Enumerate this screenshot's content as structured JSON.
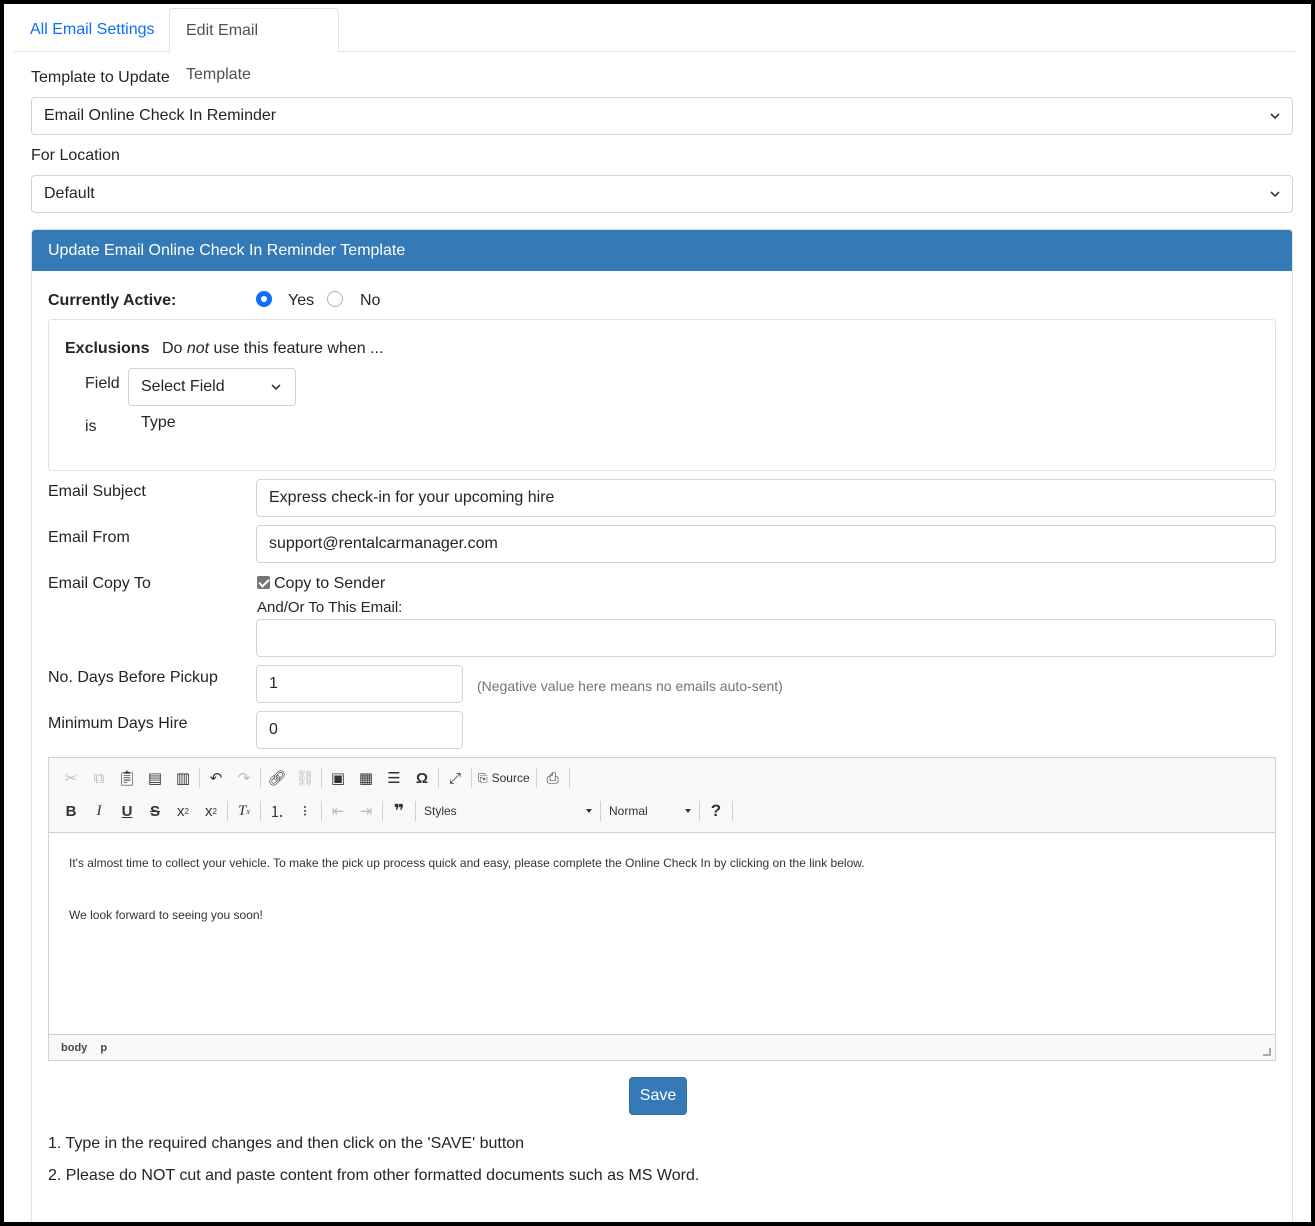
{
  "tabs": {
    "all_settings": "All Email Settings",
    "edit_template": "Edit Email Template"
  },
  "template_select": {
    "label": "Template to Update",
    "value": "Email Online Check In Reminder"
  },
  "location_select": {
    "label": "For Location",
    "value": "Default"
  },
  "panel": {
    "title": "Update Email Online Check In Reminder Template",
    "active": {
      "label": "Currently Active:",
      "yes": "Yes",
      "no": "No",
      "selected": "Yes"
    },
    "exclusions": {
      "title": "Exclusions",
      "desc_pre": "Do ",
      "desc_em": "not",
      "desc_post": " use this feature when ...",
      "field_label": "Field",
      "field_select": "Select Field Type",
      "is_label": "is"
    },
    "subject": {
      "label": "Email Subject",
      "value": "Express check-in for your upcoming hire"
    },
    "from": {
      "label": "Email From",
      "value": "support@rentalcarmanager.com"
    },
    "copy_to": {
      "label": "Email Copy To",
      "checkbox_label": "Copy to Sender",
      "checked": true,
      "extra_label": "And/Or To This Email:",
      "extra_value": ""
    },
    "days_before": {
      "label": "No. Days Before Pickup",
      "value": "1",
      "hint": "(Negative value here means no emails auto-sent)"
    },
    "min_days": {
      "label": "Minimum Days Hire",
      "value": "0"
    },
    "editor": {
      "source_label": "Source",
      "styles_label": "Styles",
      "format_label": "Normal",
      "paragraph1": "It's almost time to collect your vehicle. To make the pick up process quick and easy, please complete the Online Check In by clicking on the link below.",
      "paragraph2": "We look forward to seeing you soon!",
      "path": [
        "body",
        "p"
      ]
    },
    "save_label": "Save",
    "notes": [
      "1. Type in the required changes and then click on the 'SAVE' button",
      "2. Please do NOT cut and paste content from other formatted documents such as MS Word."
    ]
  },
  "colors": {
    "primary": "#337ab7",
    "link": "#0d6efd",
    "radio_active": "#0d6efd"
  }
}
